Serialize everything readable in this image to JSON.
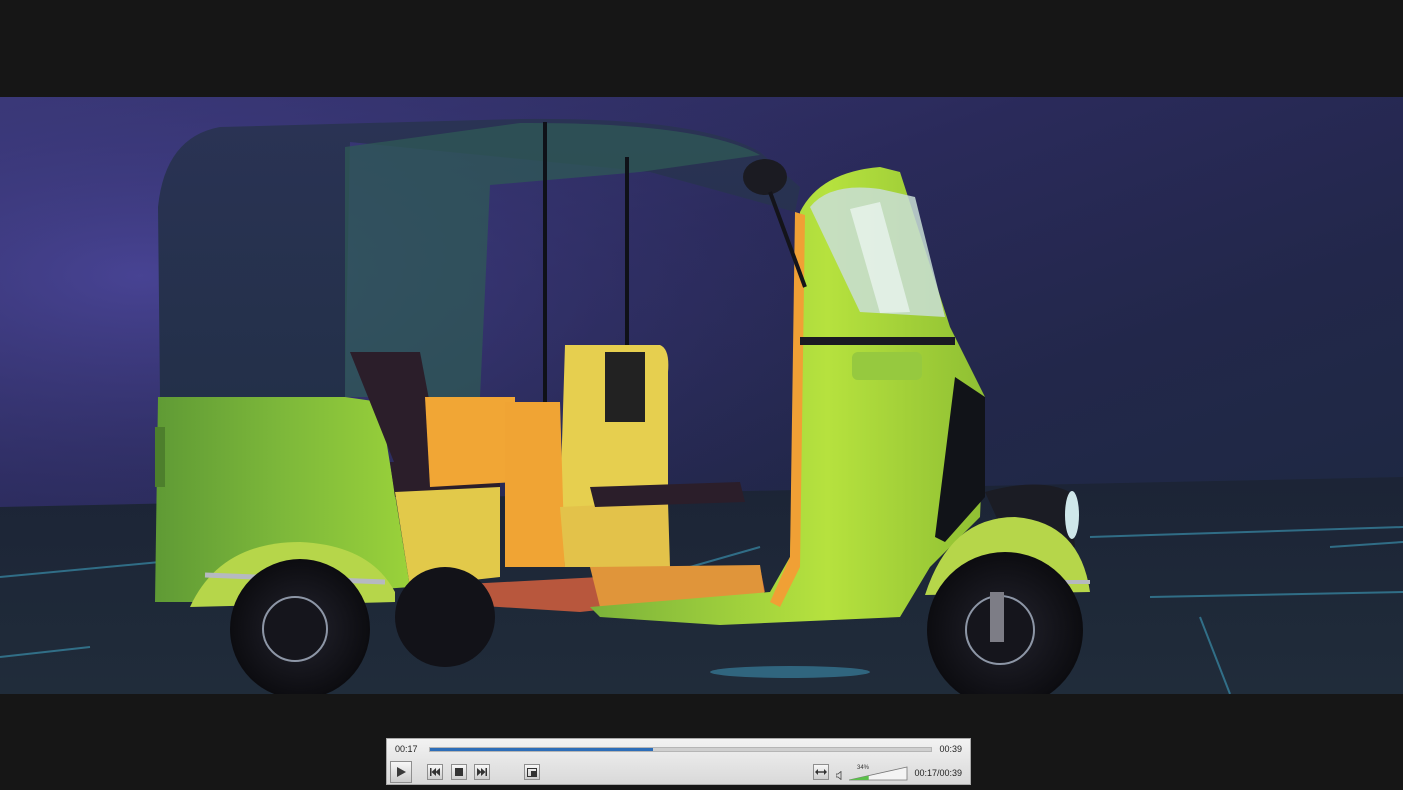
{
  "video": {
    "scene_description_icon": "video-frame-icon"
  },
  "controls": {
    "elapsed": "00:17",
    "total": "00:39",
    "progress_fraction": 0.445,
    "play_icon": "play-icon",
    "prev_icon": "skip-back-icon",
    "stop_icon": "stop-icon",
    "next_icon": "skip-forward-icon",
    "snapshot_icon": "snapshot-icon",
    "aspect_icon": "aspect-ratio-icon",
    "speaker_icon": "speaker-icon",
    "volume_percent": "34%",
    "volume_fraction": 0.34,
    "time_readout": "00:17/00:39"
  },
  "colors": {
    "seek_fill": "#2c6db8",
    "volume_fill": "#5bbf4a"
  }
}
